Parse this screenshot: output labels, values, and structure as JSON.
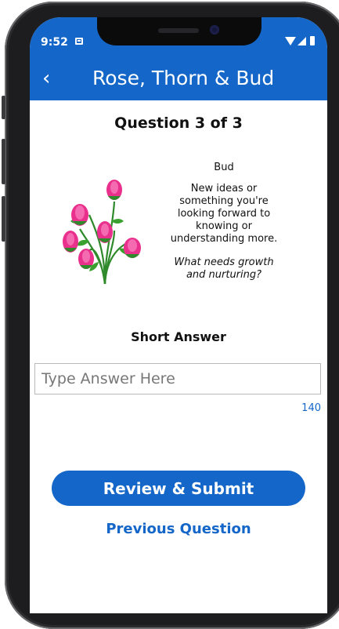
{
  "status_bar": {
    "time": "9:52",
    "icons": [
      "sim-card-icon",
      "wifi-icon",
      "cellular-signal-icon",
      "battery-icon"
    ]
  },
  "header": {
    "title": "Rose, Thorn & Bud",
    "back_icon": "chevron-left-icon"
  },
  "question": {
    "progress": "Question 3 of 3",
    "image_icon": "rose-bouquet-illustration",
    "prompt_title": "Bud",
    "prompt_body": "New ideas or something you're looking forward to knowing or understanding more.",
    "prompt_question": "What needs growth and nurturing?"
  },
  "answer": {
    "label": "Short Answer",
    "placeholder": "Type Answer Here",
    "value": "",
    "chars_remaining": "140"
  },
  "actions": {
    "submit_label": "Review & Submit",
    "previous_label": "Previous Question"
  },
  "colors": {
    "brand_blue": "#1466c8",
    "rose_pink": "#e8308c",
    "leaf_green": "#2f8a2b"
  }
}
